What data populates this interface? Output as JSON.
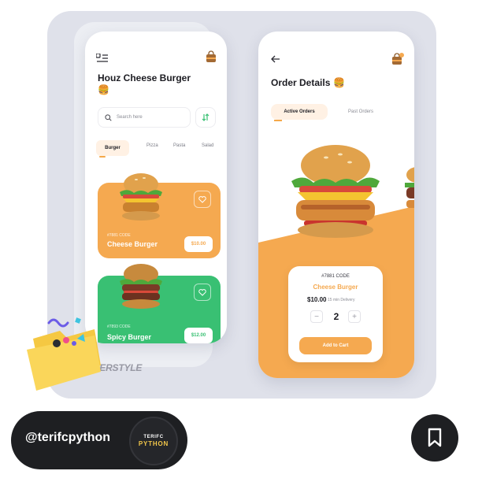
{
  "colors": {
    "accent_orange": "#f5a950",
    "accent_green": "#39c073",
    "dark": "#1e1f22",
    "board_bg": "#dfe1ea"
  },
  "phone1": {
    "title": "Houz Cheese Burger",
    "title_emoji": "🍔",
    "search_placeholder": "Search here",
    "categories": [
      "Burger",
      "Pizza",
      "Pasta",
      "Salad"
    ],
    "active_category": "Burger",
    "cards": [
      {
        "code": "#7881 CODE",
        "name": "Cheese Burger",
        "price": "$10.00",
        "color": "#f5a950"
      },
      {
        "code": "#7893 CODE",
        "name": "Spicy Burger",
        "price": "$12.00",
        "color": "#39c073"
      }
    ],
    "icons": {
      "menu": "menu-icon",
      "bag": "shopping-bag-icon",
      "search": "search-icon",
      "filter": "filter-icon",
      "heart": "heart-icon"
    }
  },
  "phone2": {
    "title": "Order Details",
    "title_emoji": "🍔",
    "tabs": {
      "active": "Active Orders",
      "inactive": "Past Orders"
    },
    "order": {
      "code": "#7881 CODE",
      "name": "Cheese Burger",
      "price": "$10.00",
      "delivery": "15 min Delivery",
      "quantity": "2",
      "minus": "−",
      "plus": "+",
      "add_button": "Add to Cart"
    },
    "icons": {
      "back": "back-arrow-icon",
      "bag": "shopping-bag-icon"
    }
  },
  "brand_text": "JPERSTYLE",
  "footer": {
    "handle": "@terifcpython",
    "logo_top": "TERIFC",
    "logo_bottom": "PYTHON",
    "bookmark_icon": "bookmark-icon"
  }
}
